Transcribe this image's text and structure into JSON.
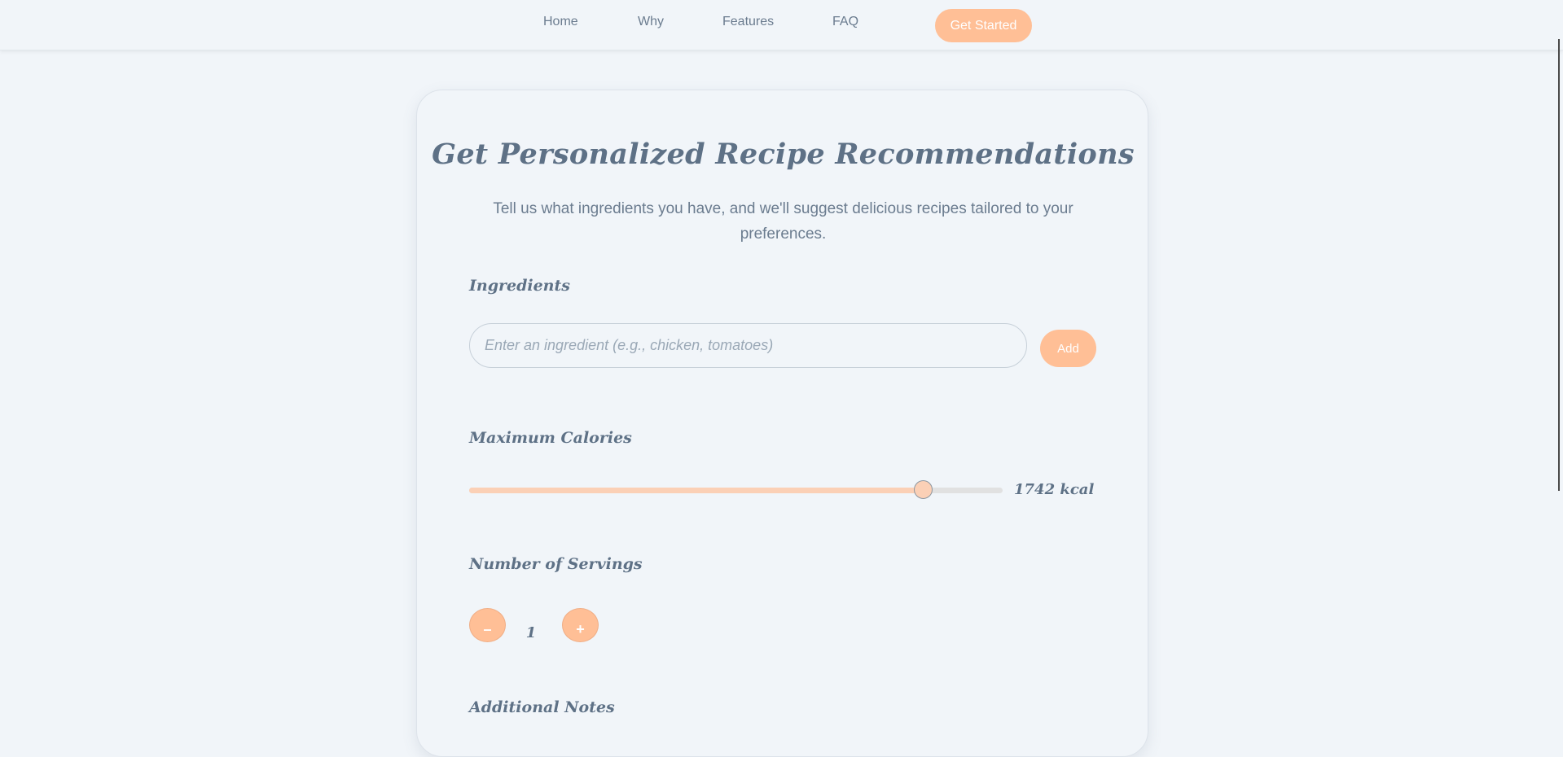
{
  "nav": {
    "links": [
      "Home",
      "Why",
      "Features",
      "FAQ"
    ],
    "cta_label": "Get Started"
  },
  "form": {
    "title": "Get Personalized Recipe Recommendations",
    "subtitle": "Tell us what ingredients you have, and we'll suggest delicious recipes tailored to your preferences.",
    "ingredients": {
      "label": "Ingredients",
      "placeholder": "Enter an ingredient (e.g., chicken, tomatoes)",
      "value": "",
      "add_label": "Add"
    },
    "calories": {
      "label": "Maximum Calories",
      "value_text": "1742 kcal",
      "level_fraction": 0.85
    },
    "servings": {
      "label": "Number of Servings",
      "decrement_label": "–",
      "value": "1",
      "increment_label": "+"
    },
    "notes": {
      "label": "Additional Notes"
    }
  },
  "colors": {
    "accent": "#ffbf96",
    "slider_fill": "#fbd0b6",
    "text": "#5e7186",
    "background": "#f1f5f9"
  }
}
